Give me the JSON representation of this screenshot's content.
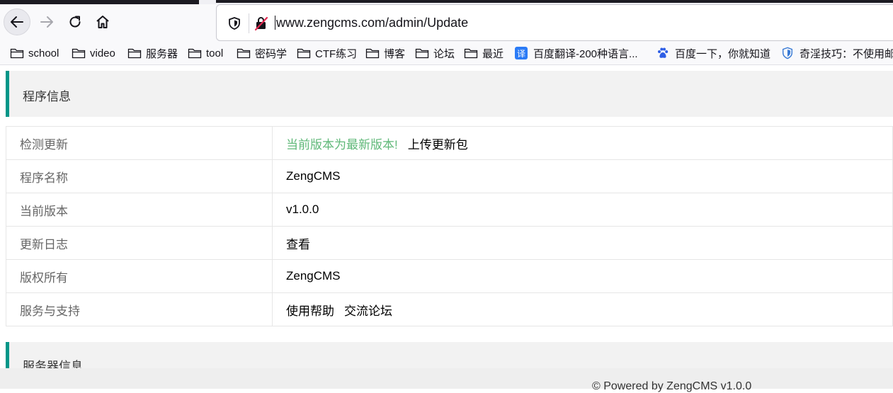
{
  "browser": {
    "url": "www.zengcms.com/admin/Update",
    "bookmarks": [
      {
        "label": "school",
        "icon": "folder-icon"
      },
      {
        "label": "video",
        "icon": "folder-icon"
      },
      {
        "label": "服务器",
        "icon": "folder-icon"
      },
      {
        "label": "tool",
        "icon": "folder-icon"
      },
      {
        "label": "密码学",
        "icon": "folder-icon"
      },
      {
        "label": "CTF练习",
        "icon": "folder-icon"
      },
      {
        "label": "博客",
        "icon": "folder-icon"
      },
      {
        "label": "论坛",
        "icon": "folder-icon"
      },
      {
        "label": "最近",
        "icon": "folder-icon"
      },
      {
        "label": "百度翻译-200种语言...",
        "icon": "translate-icon",
        "icon_text": "译"
      },
      {
        "label": "百度一下，你就知道",
        "icon": "baidu-paw-icon"
      },
      {
        "label": "奇淫技巧：不使用邮",
        "icon": "shield-icon"
      }
    ]
  },
  "program_section": {
    "title": "程序信息",
    "rows": {
      "check_update": {
        "key": "检测更新",
        "status": "当前版本为最新版本!",
        "upload_link": "上传更新包"
      },
      "name": {
        "key": "程序名称",
        "value": "ZengCMS"
      },
      "version": {
        "key": "当前版本",
        "value": "v1.0.0"
      },
      "changelog": {
        "key": "更新日志",
        "link": "查看"
      },
      "copyright": {
        "key": "版权所有",
        "value": "ZengCMS"
      },
      "support": {
        "key": "服务与支持",
        "help_link": "使用帮助",
        "forum_link": "交流论坛"
      }
    }
  },
  "server_section": {
    "title": "服务器信息"
  },
  "footer": {
    "text": "© Powered by ZengCMS v1.0.0"
  },
  "colors": {
    "accent": "#009688",
    "status_green": "#5fb878"
  }
}
